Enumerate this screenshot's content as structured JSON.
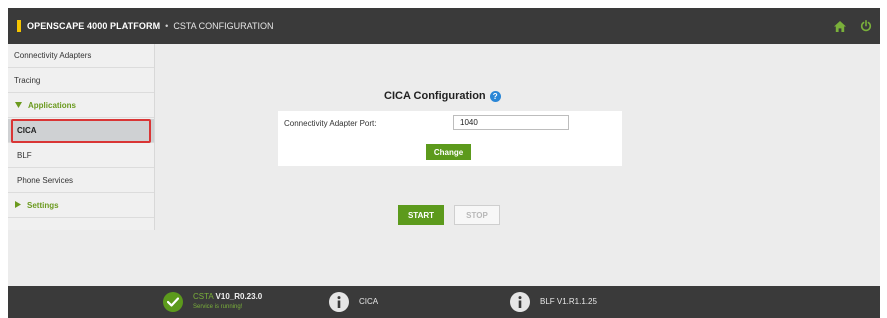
{
  "header": {
    "product": "OPENSCAPE 4000 PLATFORM",
    "separator": "•",
    "section": "CSTA CONFIGURATION",
    "icons": [
      "home-icon",
      "power-icon"
    ],
    "accent_color": "#f4c400"
  },
  "sidebar": {
    "items": [
      {
        "label": "Connectivity Adapters"
      },
      {
        "label": "Tracing"
      },
      {
        "label": "Applications",
        "group": true,
        "expanded": true
      },
      {
        "label": "CICA",
        "active": true
      },
      {
        "label": "BLF"
      },
      {
        "label": "Phone Services"
      },
      {
        "label": "Settings",
        "group": true,
        "expanded": false
      }
    ]
  },
  "main": {
    "title": "CICA Configuration",
    "help": "?",
    "field_label": "Connectivity Adapter Port:",
    "port_value": "1040",
    "change_label": "Change",
    "start_label": "START",
    "stop_label": "STOP"
  },
  "footer": {
    "service_prefix": "CSTA",
    "service_version": "V10_R0.23.0",
    "service_status": "Service is running!",
    "app_name": "CICA",
    "blf_version": "BLF V1.R1.1.25",
    "status_color": "#5c9a1c"
  }
}
